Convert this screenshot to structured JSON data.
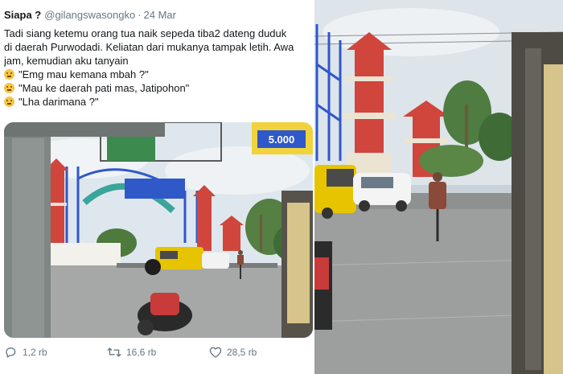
{
  "tweet": {
    "author_name": "Siapa ?",
    "handle": "@gilangswasongko",
    "separator": "·",
    "date": "24 Mar",
    "lines": [
      "Tadi siang ketemu orang tua naik sepeda tiba2 dateng duduk",
      "di daerah Purwodadi. Keliatan dari mukanya tampak letih. Awa",
      "jam, kemudian aku tanyain"
    ],
    "quotes": [
      {
        "emoji": "grinning-sweat-emoji",
        "text": "\"Emg mau kemana mbah ?\""
      },
      {
        "emoji": "grinning-sweat-emoji",
        "text": "\"Mau ke daerah pati mas, Jatipohon\""
      },
      {
        "emoji": "grinning-sweat-emoji",
        "text": "\"Lha darimana ?\""
      }
    ],
    "photo": {
      "billboard_text": "5.000"
    },
    "actions": {
      "replies": "1,2 rb",
      "retweets": "16,6 rb",
      "likes": "28,5 rb"
    }
  },
  "colors": {
    "text": "#14171a",
    "muted": "#657786",
    "sky": "#dfe7ee",
    "pavement": "#a5a8a6",
    "pagoda_red": "#d0463c",
    "scaffold_blue": "#2f58c9",
    "bus_yellow": "#e6c400"
  },
  "icons": {
    "reply": "reply-icon",
    "retweet": "retweet-icon",
    "like": "heart-icon"
  }
}
